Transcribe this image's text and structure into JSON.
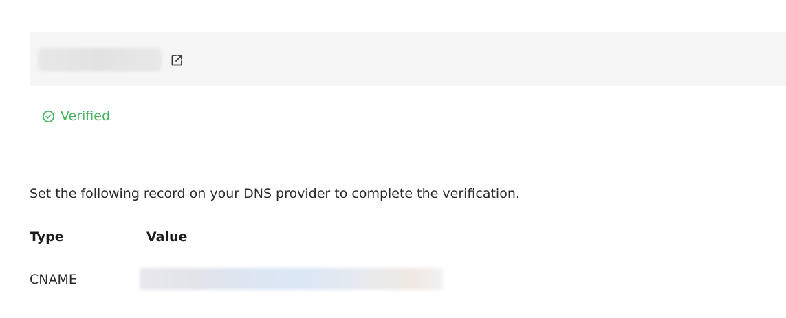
{
  "domain_bar": {
    "external_link_icon": "external-link-icon"
  },
  "status": {
    "icon": "check-circle-icon",
    "label": "Verified",
    "color": "#46b45e"
  },
  "instruction": "Set the following record on your DNS provider to complete the verification.",
  "record_table": {
    "headers": {
      "type": "Type",
      "value": "Value"
    },
    "rows": [
      {
        "type": "CNAME"
      }
    ]
  }
}
